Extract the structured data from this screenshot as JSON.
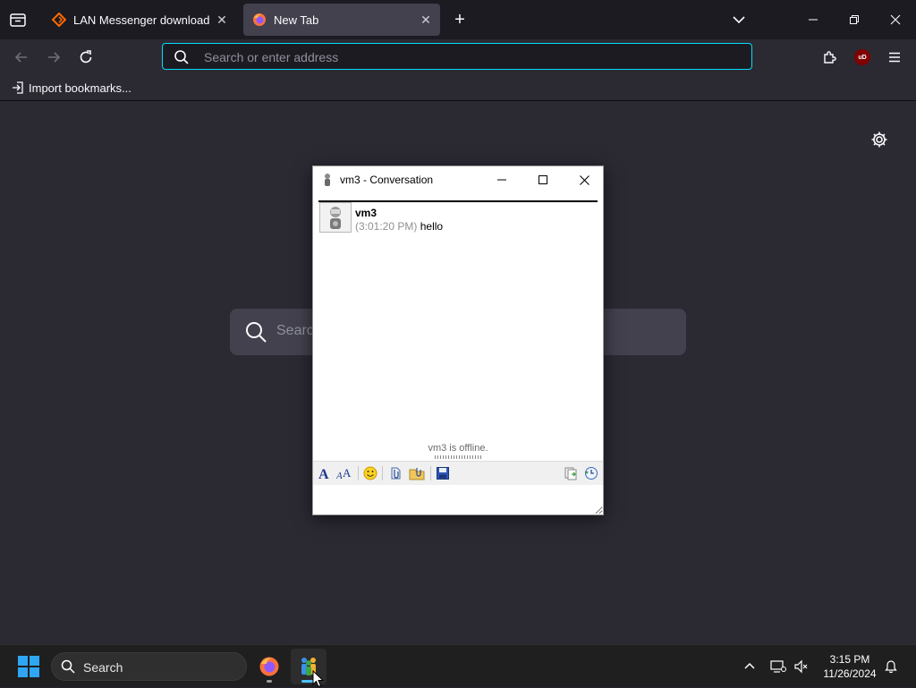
{
  "browser": {
    "tabs": [
      {
        "title": "LAN Messenger download | So",
        "active": false,
        "favicon": "sourceforge-icon"
      },
      {
        "title": "New Tab",
        "active": true,
        "favicon": "firefox-icon"
      }
    ],
    "new_tab_symbol": "+",
    "close_symbol": "✕",
    "urlbar": {
      "placeholder": "Search or enter address",
      "value": ""
    },
    "bookmarks": [
      {
        "label": "Import bookmarks..."
      }
    ],
    "new_tab_page": {
      "search_placeholder": "Search"
    },
    "accent_color": "#00ddff"
  },
  "conversation": {
    "title": "vm3 - Conversation",
    "messages": [
      {
        "sender": "vm3",
        "timestamp": "(3:01:20 PM)",
        "text": "hello"
      }
    ],
    "status": "vm3 is offline.",
    "input_value": "",
    "toolbar_icons": [
      "font-icon",
      "font-color-icon",
      "smiley-icon",
      "send-file-icon",
      "send-folder-icon",
      "save-icon",
      "copy-icon",
      "history-icon"
    ]
  },
  "taskbar": {
    "search_label": "Search",
    "apps": [
      {
        "name": "firefox-icon",
        "active": false
      },
      {
        "name": "lan-messenger-icon",
        "active": true
      }
    ],
    "clock": {
      "time": "3:15 PM",
      "date": "11/26/2024"
    }
  }
}
